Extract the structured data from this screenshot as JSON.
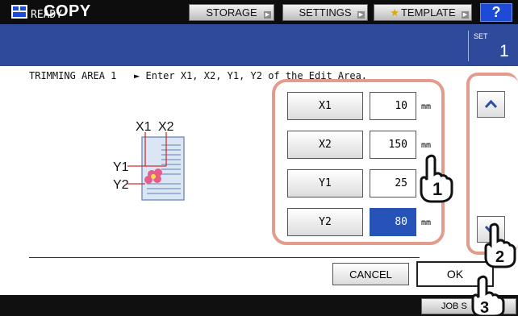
{
  "header": {
    "title": "COPY",
    "buttons": {
      "storage": "STORAGE",
      "settings": "SETTINGS",
      "template": "TEMPLATE",
      "help": "?"
    }
  },
  "status": {
    "text": "READY",
    "set_label": "SET",
    "set_count": "1"
  },
  "instruction": "TRIMMING AREA 1   ► Enter X1, X2, Y1, Y2 of the Edit Area.",
  "illustration": {
    "labels": {
      "x1": "X1",
      "x2": "X2",
      "y1": "Y1",
      "y2": "Y2"
    }
  },
  "fields": [
    {
      "label": "X1",
      "value": "10",
      "unit": "mm",
      "active": false
    },
    {
      "label": "X2",
      "value": "150",
      "unit": "mm",
      "active": false
    },
    {
      "label": "Y1",
      "value": "25",
      "unit": "mm",
      "active": false
    },
    {
      "label": "Y2",
      "value": "80",
      "unit": "mm",
      "active": true
    }
  ],
  "actions": {
    "cancel": "CANCEL",
    "ok": "OK"
  },
  "bottombar": {
    "job_status": "JOB S"
  },
  "callouts": {
    "step1": "1",
    "step2": "2",
    "step3": "3"
  },
  "icons": {
    "template_star": "star-icon",
    "scroll_up": "chevron-up-icon",
    "scroll_down": "chevron-down-icon",
    "copy_app": "copy-app-icon",
    "pointer": "hand-pointer-icon"
  },
  "colors": {
    "header_bg": "#0d0d0d",
    "status_bg": "#2f4a9b",
    "help_button": "#1d4bd6",
    "active_field": "#2752b7",
    "callout_border": "#e39c8c"
  }
}
